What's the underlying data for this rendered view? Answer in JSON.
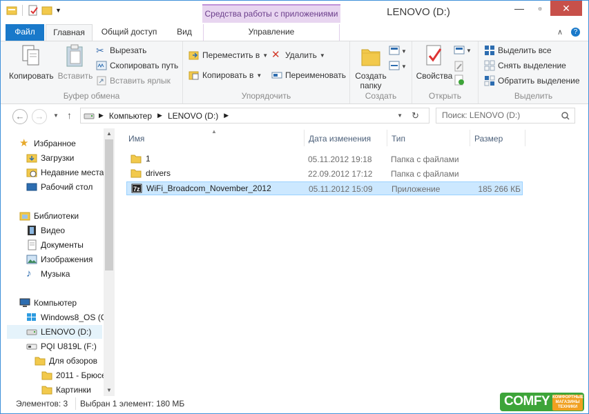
{
  "window": {
    "title": "LENOVO (D:)"
  },
  "context_tab_header": "Средства работы с приложениями",
  "tabs": {
    "file": "Файл",
    "home": "Главная",
    "share": "Общий доступ",
    "view": "Вид",
    "manage": "Управление"
  },
  "ribbon": {
    "clipboard": {
      "label": "Буфер обмена",
      "copy": "Копировать",
      "paste": "Вставить",
      "cut": "Вырезать",
      "copy_path": "Скопировать путь",
      "paste_shortcut": "Вставить ярлык"
    },
    "organize": {
      "label": "Упорядочить",
      "move_to": "Переместить в",
      "copy_to": "Копировать в",
      "delete": "Удалить",
      "rename": "Переименовать"
    },
    "create": {
      "label": "Создать",
      "new_folder_line1": "Создать",
      "new_folder_line2": "папку"
    },
    "open": {
      "label": "Открыть",
      "properties": "Свойства"
    },
    "select": {
      "label": "Выделить",
      "select_all": "Выделить все",
      "select_none": "Снять выделение",
      "invert": "Обратить выделение"
    }
  },
  "address": {
    "crumbs": [
      "Компьютер",
      "LENOVO (D:)"
    ],
    "search_placeholder": "Поиск: LENOVO (D:)"
  },
  "nav": {
    "favorites": "Избранное",
    "downloads": "Загрузки",
    "recent": "Недавние места",
    "desktop": "Рабочий стол",
    "libraries": "Библиотеки",
    "video": "Видео",
    "documents": "Документы",
    "images": "Изображения",
    "music": "Музыка",
    "computer": "Компьютер",
    "drive_c": "Windows8_OS (C",
    "drive_d": "LENOVO (D:)",
    "drive_f": "PQI U819L (F:)",
    "for_reviews": "Для обзоров",
    "folder_2011": "2011 - Брюсе",
    "pictures": "Картинки"
  },
  "columns": {
    "name": "Имя",
    "date": "Дата изменения",
    "type": "Тип",
    "size": "Размер"
  },
  "files": [
    {
      "name": "1",
      "date": "05.11.2012 19:18",
      "type": "Папка с файлами",
      "size": ""
    },
    {
      "name": "drivers",
      "date": "22.09.2012 17:12",
      "type": "Папка с файлами",
      "size": ""
    },
    {
      "name": "WiFi_Broadcom_November_2012",
      "date": "05.11.2012 15:09",
      "type": "Приложение",
      "size": "185 266 КБ"
    }
  ],
  "status": {
    "count": "Элементов: 3",
    "selection": "Выбран 1 элемент: 180 МБ"
  },
  "watermark": {
    "brand": "COMFY",
    "tagline": "КОМФОРТНЫЕ МАГАЗИНЫ ТЕХНИКИ"
  },
  "colors": {
    "accent": "#1979ca",
    "selection": "#cce8ff",
    "context": "#e8d5f0"
  }
}
